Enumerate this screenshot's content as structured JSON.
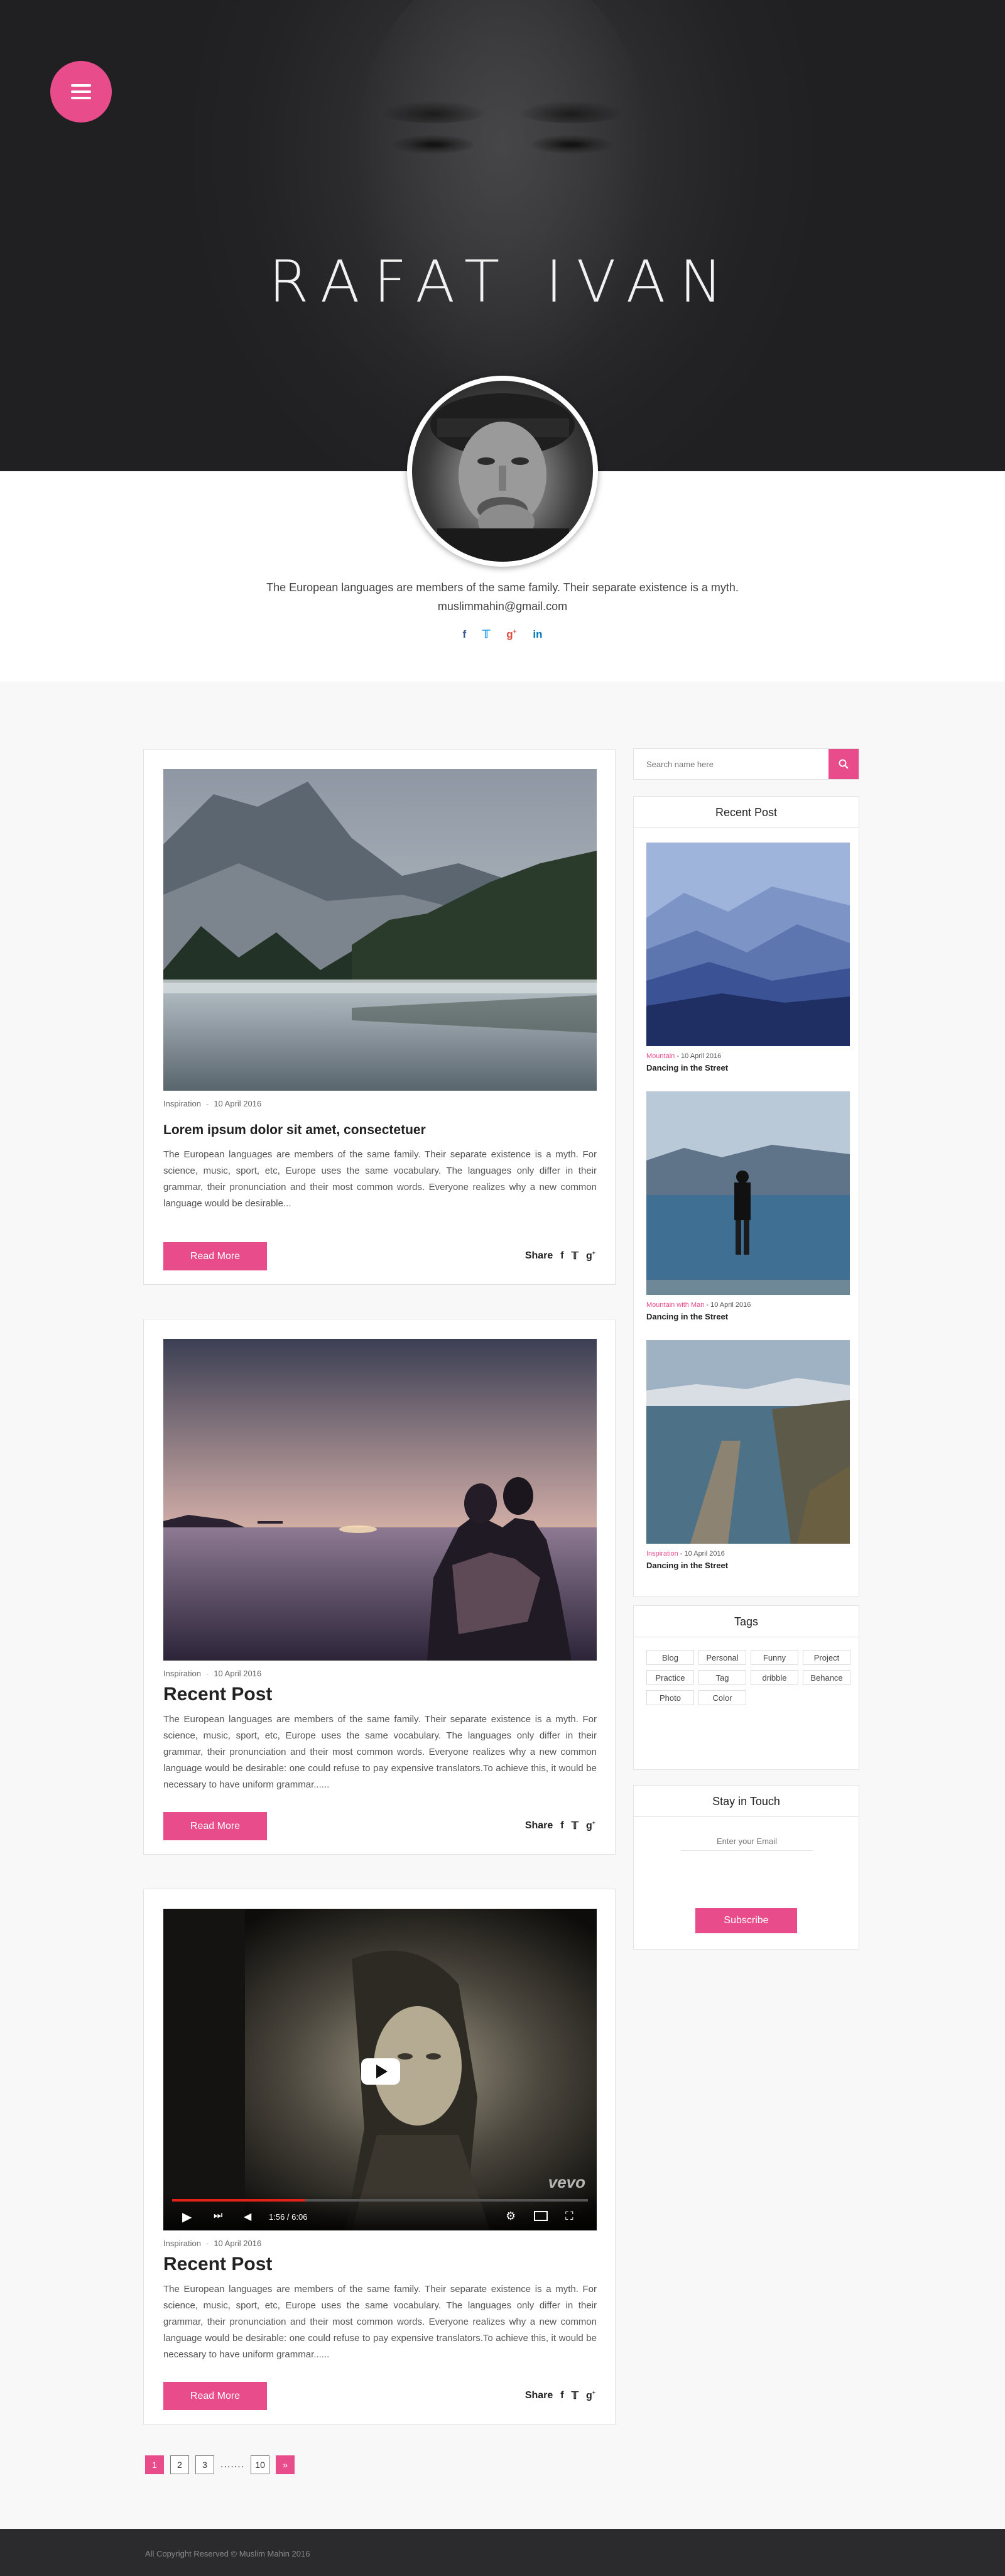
{
  "hero": {
    "title": "RAFAT IVAN",
    "menu_icon": "hamburger-menu-icon"
  },
  "profile": {
    "bio": "The European languages are members of the same family. Their separate existence is a myth.",
    "email": "muslimmahin@gmail.com",
    "socials": [
      {
        "name": "facebook",
        "glyph": "f",
        "color": "#3b5998"
      },
      {
        "name": "twitter",
        "glyph": "🐦",
        "color": "#1da1f2"
      },
      {
        "name": "google-plus",
        "glyph": "g+",
        "color": "#dd4b39"
      },
      {
        "name": "linkedin",
        "glyph": "in",
        "color": "#0077b5"
      }
    ]
  },
  "posts": [
    {
      "category": "Inspiration",
      "date": "10 April 2016",
      "title": "Lorem ipsum dolor sit amet, consectetuer",
      "excerpt": "The European languages are members of the same family. Their separate existence is a myth. For science, music, sport, etc, Europe uses the same vocabulary. The languages only differ in their grammar, their pronunciation and their most common words. Everyone realizes why a new common language would be desirable...",
      "read_more": "Read More",
      "share_label": "Share",
      "image": "misty-mountain-lake"
    },
    {
      "category": "Inspiration",
      "date": "10 April 2016",
      "title": "Recent Post",
      "excerpt": "The European languages are members of the same family. Their separate existence is a myth. For science, music, sport, etc, Europe uses the same vocabulary. The languages only differ in their grammar, their pronunciation and their most common words. Everyone realizes why a new common language would be desirable: one could refuse to pay expensive translators.To achieve this, it would be necessary to have uniform grammar......",
      "read_more": "Read More",
      "share_label": "Share",
      "image": "couple-sunset-sea"
    },
    {
      "category": "Inspiration",
      "date": "10 April 2016",
      "title": "Recent Post",
      "excerpt": "The European languages are members of the same family. Their separate existence is a myth. For science, music, sport, etc, Europe uses the same vocabulary. The languages only differ in their grammar, their pronunciation and their most common words. Everyone realizes why a new common language would be desirable: one could refuse to pay expensive translators.To achieve this, it would be necessary to have uniform grammar......",
      "read_more": "Read More",
      "share_label": "Share",
      "image": "video-player",
      "video": {
        "time": "1:56 / 6:06",
        "watermark": "vevo",
        "progress": 0.32
      }
    }
  ],
  "sidebar": {
    "search_placeholder": "Search name here",
    "recent_title": "Recent Post",
    "recent": [
      {
        "category": "Mountain",
        "date": "10 April 2016",
        "title": "Dancing in the Street",
        "image": "blue-mountains"
      },
      {
        "category": "Mountain with Man",
        "date": "10 April 2016",
        "title": "Dancing in the Street",
        "image": "man-by-lake"
      },
      {
        "category": "Inspiration",
        "date": "10 April 2016",
        "title": "Dancing in the Street",
        "image": "wooden-pier"
      }
    ],
    "tags_title": "Tags",
    "tags": [
      "Blog",
      "Personal",
      "Funny",
      "Project",
      "Practice",
      "Tag",
      "dribble",
      "Behance",
      "Photo",
      "Color"
    ],
    "stay_title": "Stay in Touch",
    "email_placeholder": "Enter your Email",
    "subscribe": "Subscribe"
  },
  "pagination": {
    "pages": [
      "1",
      "2",
      "3"
    ],
    "dots": ".......",
    "last": "10",
    "next": "»",
    "active": "1"
  },
  "footer": {
    "copyright": "All Copyright Reserved © Muslim Mahin 2016"
  },
  "colors": {
    "accent": "#e84c8b",
    "hero_bg": "#2c2c2e",
    "footer_bg": "#2b2b2d"
  }
}
